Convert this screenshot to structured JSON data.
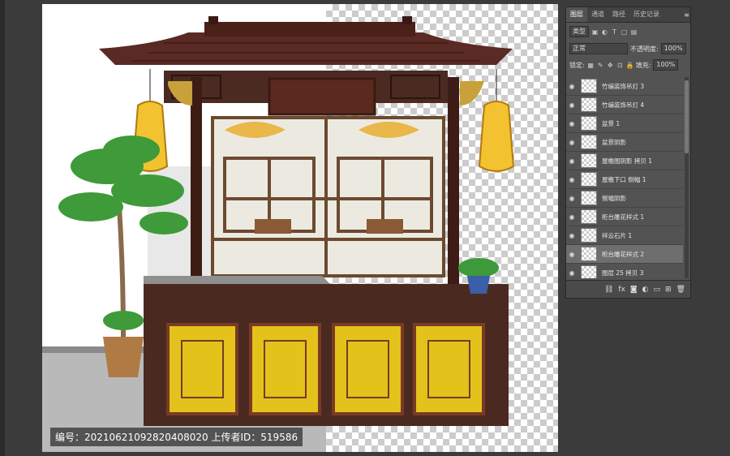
{
  "watermark_text": "编号：20210621092820408020 上传者ID：519586",
  "panel": {
    "tabs": [
      "图层",
      "通道",
      "路径",
      "历史记录"
    ],
    "active_tab": 0,
    "filter_kind": "类型",
    "blend_mode": "正常",
    "opacity_label": "不透明度:",
    "opacity_value": "100%",
    "lock_label": "锁定:",
    "fill_label": "填充:",
    "fill_value": "100%",
    "layers": [
      {
        "name": "竹编装饰吊灯 3",
        "selected": false
      },
      {
        "name": "竹编装饰吊灯 4",
        "selected": false
      },
      {
        "name": "盆景 1",
        "selected": false
      },
      {
        "name": "盆景阴影",
        "selected": false
      },
      {
        "name": "屋檐图阴影 拷贝 1",
        "selected": false
      },
      {
        "name": "屋檐下口 侧幅 1",
        "selected": false
      },
      {
        "name": "侧幅阴影",
        "selected": false
      },
      {
        "name": "柜台雕花样式 1",
        "selected": false
      },
      {
        "name": "祥云石片 1",
        "selected": false
      },
      {
        "name": "柜台雕花样式 2",
        "selected": true
      },
      {
        "name": "图层 25 拷贝 3",
        "selected": false
      }
    ],
    "footer_icons": [
      "link-icon",
      "fx-icon",
      "mask-icon",
      "adjustment-icon",
      "folder-icon",
      "new-layer-icon",
      "trash-icon"
    ]
  }
}
